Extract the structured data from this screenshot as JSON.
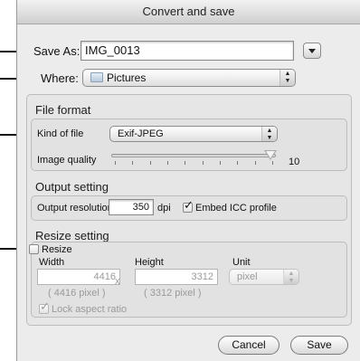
{
  "dialog": {
    "title": "Convert and save"
  },
  "save_as": {
    "label": "Save As:",
    "value": "IMG_0013"
  },
  "where": {
    "label": "Where:",
    "value": "Pictures",
    "icon": "folder-icon"
  },
  "file_format": {
    "title": "File format",
    "kind_label": "Kind of file",
    "kind_value": "Exif-JPEG",
    "quality_label": "Image quality",
    "quality_value": "10",
    "quality_level": 10,
    "quality_max": 10
  },
  "output_setting": {
    "title": "Output setting",
    "resolution_label": "Output resolution",
    "resolution_value": "350",
    "resolution_unit": "dpi",
    "embed_icc_label": "Embed ICC profile",
    "embed_icc_checked": true
  },
  "resize_setting": {
    "title": "Resize setting",
    "resize_label": "Resize",
    "resize_checked": false,
    "width_label": "Width",
    "width_value": "4416",
    "width_pixel_note": "( 4416 pixel )",
    "times": "x",
    "height_label": "Height",
    "height_value": "3312",
    "height_pixel_note": "( 3312 pixel )",
    "unit_label": "Unit",
    "unit_value": "pixel",
    "lock_aspect_label": "Lock aspect ratio",
    "lock_aspect_checked": true
  },
  "buttons": {
    "cancel": "Cancel",
    "save": "Save"
  }
}
